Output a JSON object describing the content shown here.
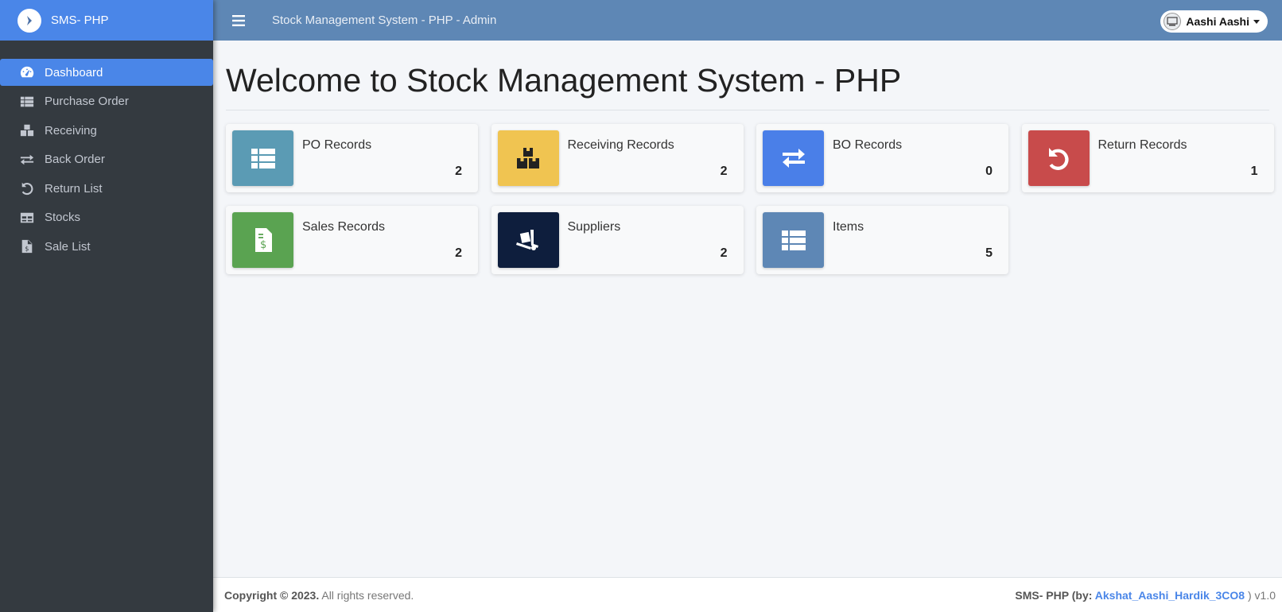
{
  "brand": {
    "name": "SMS- PHP",
    "logo_icon": "logo-icon"
  },
  "header": {
    "title": "Stock Management System - PHP - Admin",
    "user_name": "Aashi Aashi"
  },
  "sidebar": {
    "items": [
      {
        "label": "Dashboard",
        "icon": "tachometer-icon",
        "active": true
      },
      {
        "label": "Purchase Order",
        "icon": "list-table-icon"
      },
      {
        "label": "Receiving",
        "icon": "boxes-icon"
      },
      {
        "label": "Back Order",
        "icon": "exchange-icon"
      },
      {
        "label": "Return List",
        "icon": "undo-icon"
      },
      {
        "label": "Stocks",
        "icon": "table-icon"
      },
      {
        "label": "Sale List",
        "icon": "invoice-dollar-icon"
      }
    ]
  },
  "main": {
    "title": "Welcome to Stock Management System - PHP",
    "cards": [
      {
        "label": "PO Records",
        "count": "2",
        "color": "#5b9bb4",
        "icon": "list-table-icon"
      },
      {
        "label": "Receiving Records",
        "count": "2",
        "color": "#f0c451",
        "icon": "boxes-icon"
      },
      {
        "label": "BO Records",
        "count": "0",
        "color": "#4a7fe8",
        "icon": "exchange-icon"
      },
      {
        "label": "Return Records",
        "count": "1",
        "color": "#c84b4b",
        "icon": "undo-icon"
      },
      {
        "label": "Sales Records",
        "count": "2",
        "color": "#5aa351",
        "icon": "invoice-dollar-icon"
      },
      {
        "label": "Suppliers",
        "count": "2",
        "color": "#0e1e3d",
        "icon": "dolly-icon"
      },
      {
        "label": "Items",
        "count": "5",
        "color": "#5e87b5",
        "icon": "list-table-icon"
      }
    ]
  },
  "footer": {
    "copyright_bold": "Copyright © 2023.",
    "copyright_rest": " All rights reserved.",
    "credit_prefix": "SMS- PHP (by: ",
    "credit_link": "Akshat_Aashi_Hardik_3CO8",
    "credit_suffix": " ) v1.0"
  }
}
